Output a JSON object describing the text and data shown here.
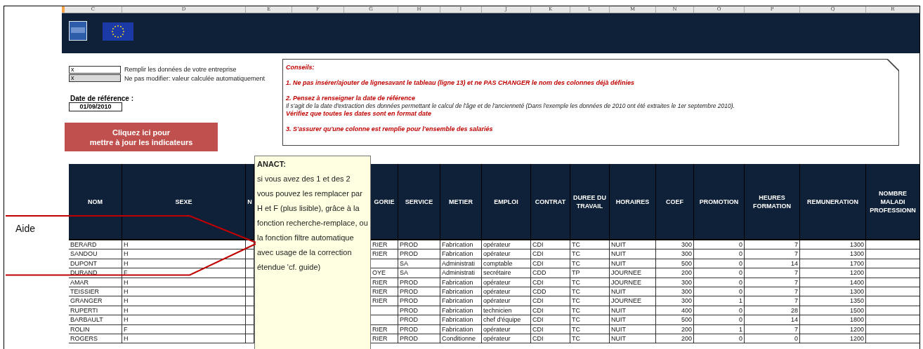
{
  "side_label": "Aide",
  "column_letters": [
    {
      "label": "C"
    },
    {
      "label": "D"
    },
    {
      "label": "E"
    },
    {
      "label": "F"
    },
    {
      "label": "G"
    },
    {
      "label": "H"
    },
    {
      "label": "I"
    },
    {
      "label": "J"
    },
    {
      "label": "K"
    },
    {
      "label": "L"
    },
    {
      "label": "M"
    },
    {
      "label": "N"
    },
    {
      "label": "O"
    },
    {
      "label": "P"
    },
    {
      "label": "Q"
    },
    {
      "label": "R"
    }
  ],
  "legend": [
    {
      "marker": "x",
      "label": "Remplir les données de votre entreprise",
      "kind": "input"
    },
    {
      "marker": "x",
      "label": "Ne pas modifier: valeur calculée automatiquement",
      "kind": "computed"
    }
  ],
  "reference_date": {
    "label": "Date de référence :",
    "value": "01/09/2010"
  },
  "update_button": {
    "lines": [
      "Cliquez ici pour",
      "mettre à jour les indicateurs"
    ]
  },
  "advice": [
    {
      "kind": "heading",
      "text": "Conseils:"
    },
    {
      "kind": "rule",
      "text": "1. Ne pas insérer/ajouter de lignesavant le tableau  (ligne 13) et ne PAS CHANGER  le nom des colonnes déjà définies"
    },
    {
      "kind": "rule",
      "text": "2. Pensez à renseigner  la date de référence"
    },
    {
      "kind": "note",
      "text": "Il s'agit de la date d'extraction des données permettant le calcul de l'âge et de l'ancienneté (Dans l'exemple les données de 2010 ont été extraites le 1er septembre 2010)."
    },
    {
      "kind": "reminder",
      "text": "Vérifiez que toutes les dates sont en format date"
    },
    {
      "kind": "rule",
      "text": "3. S'assurer qu'une colonne est remplie pour l'ensemble des salariés"
    }
  ],
  "table": {
    "columns": [
      {
        "label": "NOM"
      },
      {
        "label": "SEXE"
      },
      {
        "label": "N"
      },
      {
        "label": "GORIE"
      },
      {
        "label": "SERVICE"
      },
      {
        "label": "METIER"
      },
      {
        "label": "EMPLOI"
      },
      {
        "label": "CONTRAT"
      },
      {
        "label": "DUREE DU TRAVAIL"
      },
      {
        "label": "HORAIRES"
      },
      {
        "label": "COEF"
      },
      {
        "label": "PROMOTION"
      },
      {
        "label": "HEURES FORMATION"
      },
      {
        "label": "REMUNERATION"
      },
      {
        "label": "NOMBRE MALADI PROFESSIONN"
      }
    ],
    "rows": [
      [
        "BERARD",
        "H",
        null,
        "RIER",
        "PROD",
        "Fabrication",
        "opérateur",
        "CDI",
        "TC",
        "NUIT",
        "300",
        "0",
        "7",
        "1300",
        null
      ],
      [
        "SANDOU",
        "H",
        null,
        "RIER",
        "PROD",
        "Fabrication",
        "opérateur",
        "CDI",
        "TC",
        "NUIT",
        "300",
        "0",
        "7",
        "1300",
        null
      ],
      [
        "DUPONT",
        "H",
        null,
        null,
        "SA",
        "Administrati",
        "comptable",
        "CDI",
        "TC",
        "NUIT",
        "500",
        "0",
        "14",
        "1700",
        null
      ],
      [
        "DURAND",
        "F",
        null,
        "OYE",
        "SA",
        "Administrati",
        "secrétaire",
        "CDD",
        "TP",
        "JOURNEE",
        "200",
        "0",
        "7",
        "1200",
        null
      ],
      [
        "AMAR",
        "H",
        null,
        "RIER",
        "PROD",
        "Fabrication",
        "opérateur",
        "CDI",
        "TC",
        "JOURNEE",
        "300",
        "0",
        "7",
        "1400",
        null
      ],
      [
        "TEISSIER",
        "H",
        null,
        "RIER",
        "PROD",
        "Fabrication",
        "opérateur",
        "CDD",
        "TC",
        "NUIT",
        "300",
        "0",
        "7",
        "1300",
        null
      ],
      [
        "GRANGER",
        "H",
        null,
        "RIER",
        "PROD",
        "Fabrication",
        "opérateur",
        "CDI",
        "TC",
        "JOURNEE",
        "300",
        "1",
        "7",
        "1350",
        null
      ],
      [
        "RUPERTI",
        "H",
        null,
        null,
        "PROD",
        "Fabrication",
        "technicien",
        "CDI",
        "TC",
        "NUIT",
        "400",
        "0",
        "28",
        "1500",
        null
      ],
      [
        "BARBAULT",
        "H",
        null,
        null,
        "PROD",
        "Fabrication",
        "chef d'équipe",
        "CDI",
        "TC",
        "NUIT",
        "500",
        "0",
        "14",
        "1800",
        null
      ],
      [
        "ROLIN",
        "F",
        null,
        "RIER",
        "PROD",
        "Fabrication",
        "opérateur",
        "CDI",
        "TC",
        "NUIT",
        "200",
        "1",
        "7",
        "1200",
        null
      ],
      [
        "ROGERS",
        "H",
        null,
        "RIER",
        "PROD",
        "Conditionne",
        "opérateur",
        "CDI",
        "TC",
        "NUIT",
        "200",
        "0",
        "0",
        "1200",
        null
      ]
    ]
  },
  "comment": {
    "author": "ANACT:",
    "text": "si vous avez des 1 et des 2 vous pouvez les remplacer par H et F (plus lisible), grâce à la fonction recherche-remplace, ou la fonction filtre automatique avec usage de la correction étendue 'cf. guide)"
  }
}
